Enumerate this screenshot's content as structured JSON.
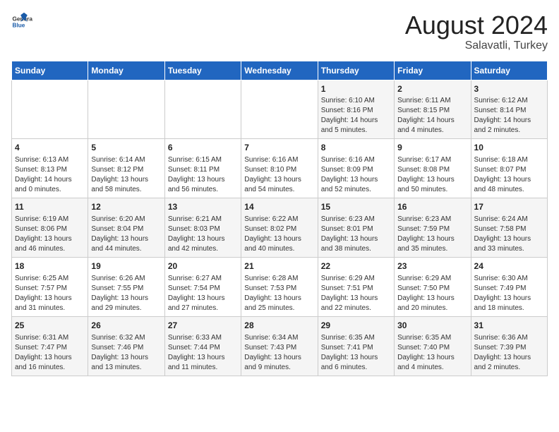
{
  "logo": {
    "text_general": "General",
    "text_blue": "Blue"
  },
  "title": "August 2024",
  "subtitle": "Salavatli, Turkey",
  "days_of_week": [
    "Sunday",
    "Monday",
    "Tuesday",
    "Wednesday",
    "Thursday",
    "Friday",
    "Saturday"
  ],
  "weeks": [
    [
      {
        "num": "",
        "info": ""
      },
      {
        "num": "",
        "info": ""
      },
      {
        "num": "",
        "info": ""
      },
      {
        "num": "",
        "info": ""
      },
      {
        "num": "1",
        "info": "Sunrise: 6:10 AM\nSunset: 8:16 PM\nDaylight: 14 hours\nand 5 minutes."
      },
      {
        "num": "2",
        "info": "Sunrise: 6:11 AM\nSunset: 8:15 PM\nDaylight: 14 hours\nand 4 minutes."
      },
      {
        "num": "3",
        "info": "Sunrise: 6:12 AM\nSunset: 8:14 PM\nDaylight: 14 hours\nand 2 minutes."
      }
    ],
    [
      {
        "num": "4",
        "info": "Sunrise: 6:13 AM\nSunset: 8:13 PM\nDaylight: 14 hours\nand 0 minutes."
      },
      {
        "num": "5",
        "info": "Sunrise: 6:14 AM\nSunset: 8:12 PM\nDaylight: 13 hours\nand 58 minutes."
      },
      {
        "num": "6",
        "info": "Sunrise: 6:15 AM\nSunset: 8:11 PM\nDaylight: 13 hours\nand 56 minutes."
      },
      {
        "num": "7",
        "info": "Sunrise: 6:16 AM\nSunset: 8:10 PM\nDaylight: 13 hours\nand 54 minutes."
      },
      {
        "num": "8",
        "info": "Sunrise: 6:16 AM\nSunset: 8:09 PM\nDaylight: 13 hours\nand 52 minutes."
      },
      {
        "num": "9",
        "info": "Sunrise: 6:17 AM\nSunset: 8:08 PM\nDaylight: 13 hours\nand 50 minutes."
      },
      {
        "num": "10",
        "info": "Sunrise: 6:18 AM\nSunset: 8:07 PM\nDaylight: 13 hours\nand 48 minutes."
      }
    ],
    [
      {
        "num": "11",
        "info": "Sunrise: 6:19 AM\nSunset: 8:06 PM\nDaylight: 13 hours\nand 46 minutes."
      },
      {
        "num": "12",
        "info": "Sunrise: 6:20 AM\nSunset: 8:04 PM\nDaylight: 13 hours\nand 44 minutes."
      },
      {
        "num": "13",
        "info": "Sunrise: 6:21 AM\nSunset: 8:03 PM\nDaylight: 13 hours\nand 42 minutes."
      },
      {
        "num": "14",
        "info": "Sunrise: 6:22 AM\nSunset: 8:02 PM\nDaylight: 13 hours\nand 40 minutes."
      },
      {
        "num": "15",
        "info": "Sunrise: 6:23 AM\nSunset: 8:01 PM\nDaylight: 13 hours\nand 38 minutes."
      },
      {
        "num": "16",
        "info": "Sunrise: 6:23 AM\nSunset: 7:59 PM\nDaylight: 13 hours\nand 35 minutes."
      },
      {
        "num": "17",
        "info": "Sunrise: 6:24 AM\nSunset: 7:58 PM\nDaylight: 13 hours\nand 33 minutes."
      }
    ],
    [
      {
        "num": "18",
        "info": "Sunrise: 6:25 AM\nSunset: 7:57 PM\nDaylight: 13 hours\nand 31 minutes."
      },
      {
        "num": "19",
        "info": "Sunrise: 6:26 AM\nSunset: 7:55 PM\nDaylight: 13 hours\nand 29 minutes."
      },
      {
        "num": "20",
        "info": "Sunrise: 6:27 AM\nSunset: 7:54 PM\nDaylight: 13 hours\nand 27 minutes."
      },
      {
        "num": "21",
        "info": "Sunrise: 6:28 AM\nSunset: 7:53 PM\nDaylight: 13 hours\nand 25 minutes."
      },
      {
        "num": "22",
        "info": "Sunrise: 6:29 AM\nSunset: 7:51 PM\nDaylight: 13 hours\nand 22 minutes."
      },
      {
        "num": "23",
        "info": "Sunrise: 6:29 AM\nSunset: 7:50 PM\nDaylight: 13 hours\nand 20 minutes."
      },
      {
        "num": "24",
        "info": "Sunrise: 6:30 AM\nSunset: 7:49 PM\nDaylight: 13 hours\nand 18 minutes."
      }
    ],
    [
      {
        "num": "25",
        "info": "Sunrise: 6:31 AM\nSunset: 7:47 PM\nDaylight: 13 hours\nand 16 minutes."
      },
      {
        "num": "26",
        "info": "Sunrise: 6:32 AM\nSunset: 7:46 PM\nDaylight: 13 hours\nand 13 minutes."
      },
      {
        "num": "27",
        "info": "Sunrise: 6:33 AM\nSunset: 7:44 PM\nDaylight: 13 hours\nand 11 minutes."
      },
      {
        "num": "28",
        "info": "Sunrise: 6:34 AM\nSunset: 7:43 PM\nDaylight: 13 hours\nand 9 minutes."
      },
      {
        "num": "29",
        "info": "Sunrise: 6:35 AM\nSunset: 7:41 PM\nDaylight: 13 hours\nand 6 minutes."
      },
      {
        "num": "30",
        "info": "Sunrise: 6:35 AM\nSunset: 7:40 PM\nDaylight: 13 hours\nand 4 minutes."
      },
      {
        "num": "31",
        "info": "Sunrise: 6:36 AM\nSunset: 7:39 PM\nDaylight: 13 hours\nand 2 minutes."
      }
    ]
  ]
}
